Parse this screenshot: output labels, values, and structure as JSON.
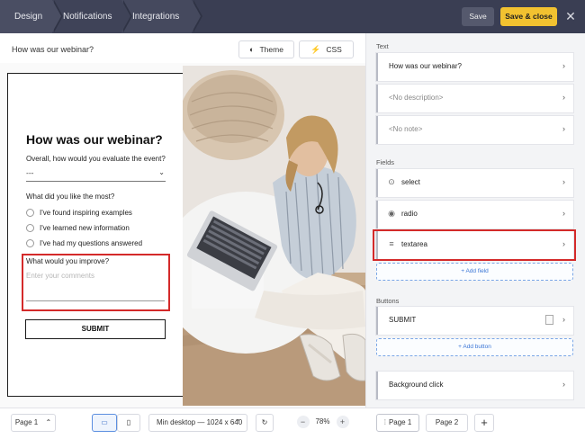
{
  "topbar": {
    "tabs": [
      "Design",
      "Notifications",
      "Integrations"
    ],
    "save_label": "Save",
    "save_close_label": "Save & close",
    "close_glyph": "✕"
  },
  "editor": {
    "survey_name": "How was our webinar?",
    "theme_label": "Theme",
    "css_label": "CSS"
  },
  "form": {
    "title": "How was our webinar?",
    "q1_label": "Overall, how would you evaluate the event?",
    "q1_value": "---",
    "q2_label": "What did you like the most?",
    "q2_options": [
      "I've found inspiring examples",
      "I've learned new information",
      "I've had my questions answered"
    ],
    "q3_label": "What would you improve?",
    "q3_placeholder": "Enter your comments",
    "submit_label": "SUBMIT"
  },
  "panel": {
    "text_section": "Text",
    "text_items": [
      "How was our webinar?",
      "<No description>",
      "<No note>"
    ],
    "fields_section": "Fields",
    "fields": [
      {
        "label": "select",
        "icon": "select-icon"
      },
      {
        "label": "radio",
        "icon": "radio-icon"
      },
      {
        "label": "textarea",
        "icon": "textarea-icon"
      }
    ],
    "add_field": "+ Add field",
    "buttons_section": "Buttons",
    "button_item": "SUBMIT",
    "add_button": "+ Add button",
    "background_click": "Background click"
  },
  "bottom": {
    "page_select": "Page 1",
    "device_select": "Min desktop — 1024 x 640",
    "zoom": "78%",
    "pages": [
      "Page 1",
      "Page 2"
    ]
  },
  "colors": {
    "topbar": "#3a3e53",
    "accent_yellow": "#f2c230",
    "highlight_red": "#d42a2a",
    "link_blue": "#3b76d6"
  }
}
